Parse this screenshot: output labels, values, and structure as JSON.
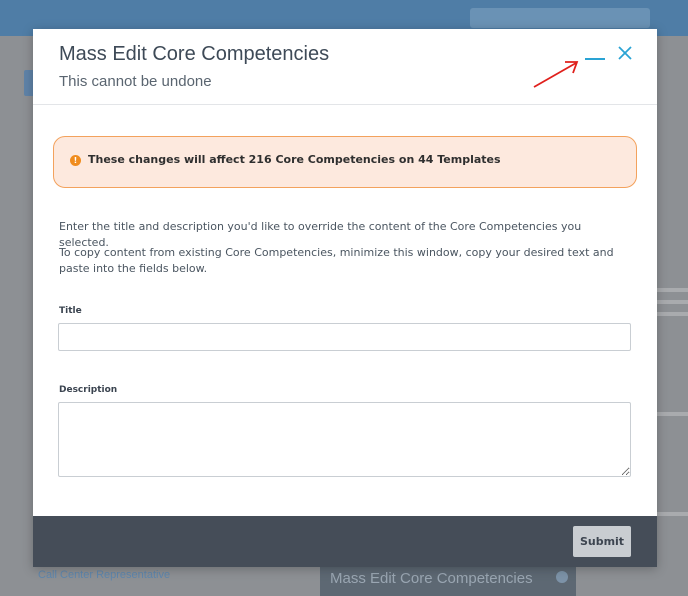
{
  "background": {
    "footer_link": "Call Center Representative",
    "minimized_bar_title": "Mass Edit Core Competencies"
  },
  "modal": {
    "title": "Mass Edit Core Competencies",
    "subtitle": "This cannot be undone",
    "minimize_icon": "minimize-icon",
    "close_icon": "close-icon",
    "alert": {
      "icon": "warning-icon",
      "text": "These changes will affect 216 Core Competencies on 44 Templates",
      "color": "#f08c1e"
    },
    "instructions": [
      "Enter the title and description you'd like to override the content of the Core Competencies you selected.",
      "To copy content from existing Core Competencies, minimize this window, copy your desired text and paste into the fields below."
    ],
    "fields": {
      "title_label": "Title",
      "title_value": "",
      "description_label": "Description",
      "description_value": ""
    },
    "submit_label": "Submit"
  },
  "colors": {
    "accent": "#2aa3d4",
    "footer": "#454d58",
    "annotation_arrow": "#e0201c"
  }
}
